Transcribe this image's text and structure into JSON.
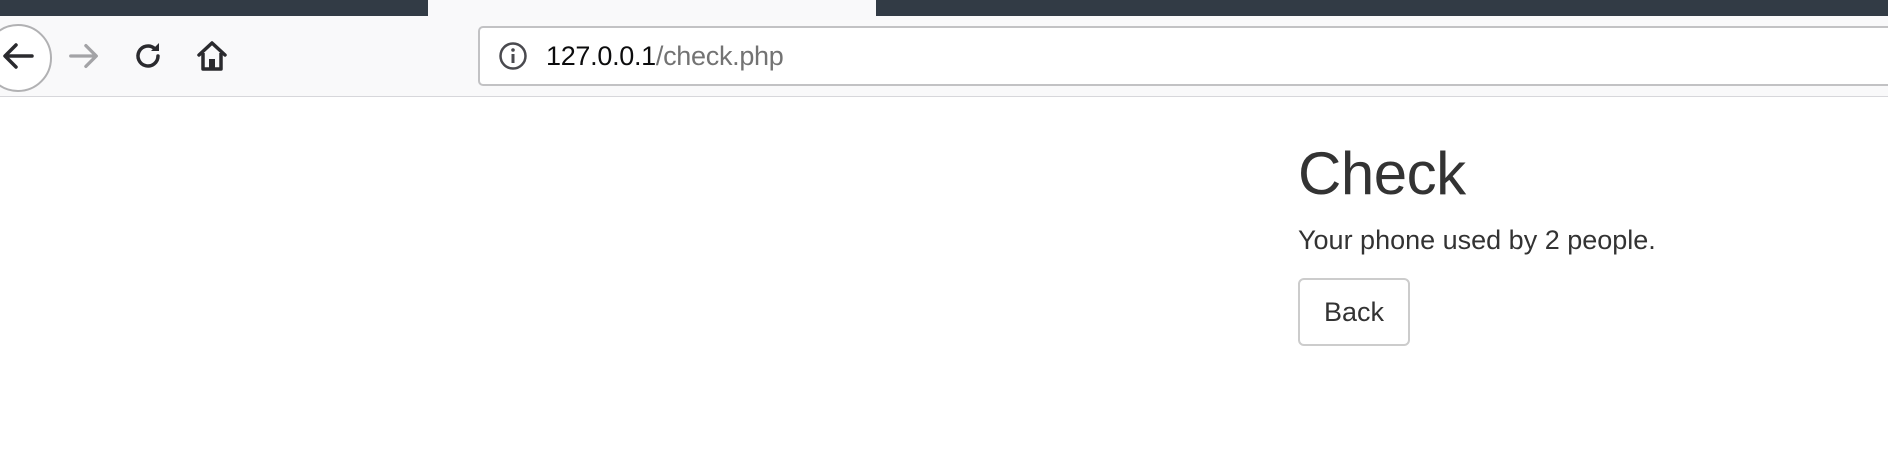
{
  "browser": {
    "url_host": "127.0.0.1",
    "url_path": "/check.php",
    "colors": {
      "tabstrip": "#323b45",
      "toolbar": "#f9f9fa",
      "url_path": "#737373"
    }
  },
  "page": {
    "title": "Check",
    "message": "Your phone used by 2 people.",
    "back_label": "Back"
  }
}
